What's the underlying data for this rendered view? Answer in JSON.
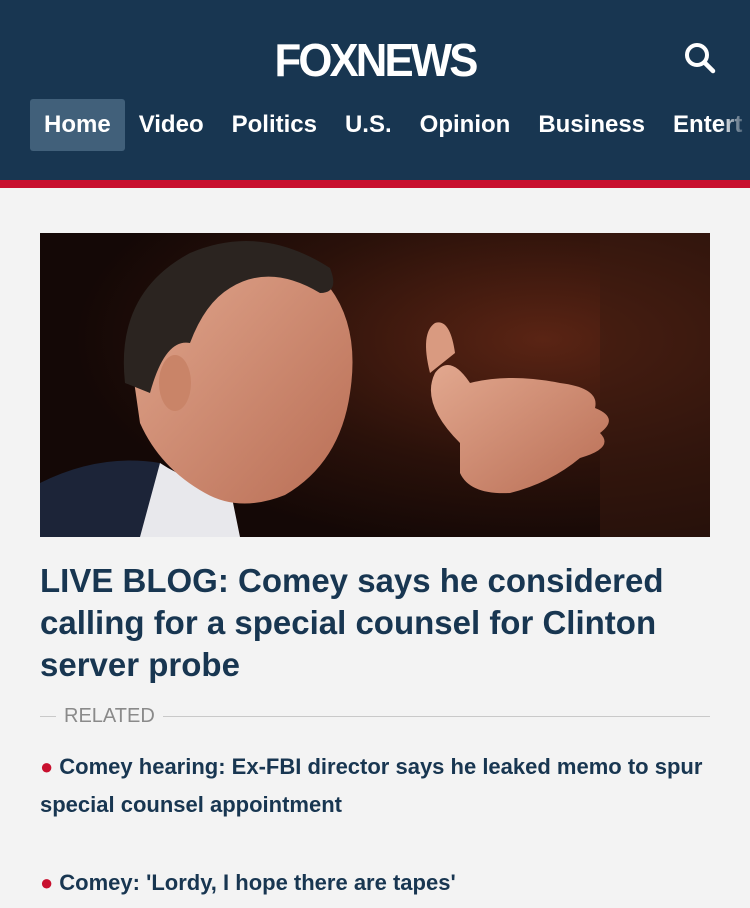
{
  "header": {
    "logo_text": "FOXNEWS",
    "search_icon": "search-icon",
    "nav": [
      {
        "label": "Home",
        "active": true
      },
      {
        "label": "Video"
      },
      {
        "label": "Politics"
      },
      {
        "label": "U.S."
      },
      {
        "label": "Opinion"
      },
      {
        "label": "Business"
      },
      {
        "label": "Entert"
      }
    ]
  },
  "main": {
    "headline": "LIVE BLOG: Comey says he considered calling for a special counsel for Clinton server probe",
    "related_label": "RELATED",
    "related": [
      "Comey hearing: Ex-FBI director says he leaked memo to spur special counsel appointment",
      "Comey: 'Lordy, I hope there are tapes'"
    ]
  },
  "colors": {
    "header_bg": "#183651",
    "accent_red": "#c8102e",
    "headline": "#183651",
    "page_bg": "#f3f3f3"
  }
}
